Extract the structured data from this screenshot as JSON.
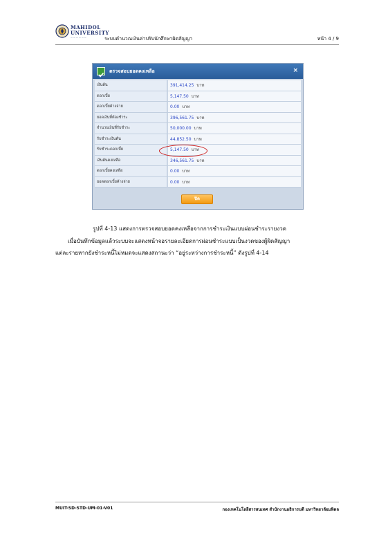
{
  "header": {
    "logo_name_line1": "MAHIDOL",
    "logo_name_line2": "UNIVERSITY",
    "title": "ระบบคำนวณเงินค่าปรับนักศึกษาผิดสัญญา",
    "page": "หน้า 4 / 9"
  },
  "dialog": {
    "title": "ตรวจสอบยอดคงเหลือ",
    "close_icon": "×",
    "rows": [
      {
        "label": "เงินต้น",
        "value": "391,414.25",
        "unit": "บาท"
      },
      {
        "label": "ดอกเบี้ย",
        "value": "5,147.50",
        "unit": "บาท"
      },
      {
        "label": "ดอกเบี้ยค้างจ่าย",
        "value": "0.00",
        "unit": "บาท"
      },
      {
        "label": "ยอดเงินที่ต้องชำระ",
        "value": "396,561.75",
        "unit": "บาท"
      },
      {
        "label": "จำนวนเงินที่รับชำระ",
        "value": "50,000.00",
        "unit": "บาท"
      },
      {
        "label": "รับชำระเงินต้น",
        "value": "44,852.50",
        "unit": "บาท"
      },
      {
        "label": "รับชำระดอกเบี้ย",
        "value": "5,147.50",
        "unit": "บาท"
      },
      {
        "label": "เงินต้นคงเหลือ",
        "value": "346,561.75",
        "unit": "บาท"
      },
      {
        "label": "ดอกเบี้ยคงเหลือ",
        "value": "0.00",
        "unit": "บาท"
      },
      {
        "label": "ยอดดอกเบี้ยค้างจ่าย",
        "value": "0.00",
        "unit": "บาท"
      }
    ],
    "close_button": "ปิด"
  },
  "body": {
    "caption": "รูปที่ 4-13 แสดงการตรวจสอบยอดคงเหลือจากการชำระเงินแบบผ่อนชำระรายงวด",
    "para_line1": "เมื่อบันทึกข้อมูลแล้วระบบจะแสดงหน้าจอรายละเอียดการผ่อนชำระแบบเป็นงวดของผู้ผิดสัญญา",
    "para_line2": "แต่ละรายหากยังชำระหนี้ไม่หมดจะแสดงสถานะว่า “อยู่ระหว่างการชำระหนี้” ดังรูปที่ 4-14"
  },
  "footer": {
    "doc_code": "MUIT-SD-STD-UM-01-V01",
    "org": "กองเทคโนโลยีสารสนเทศ สำนักงานอธิการบดี มหาวิทยาลัยมหิดล"
  }
}
